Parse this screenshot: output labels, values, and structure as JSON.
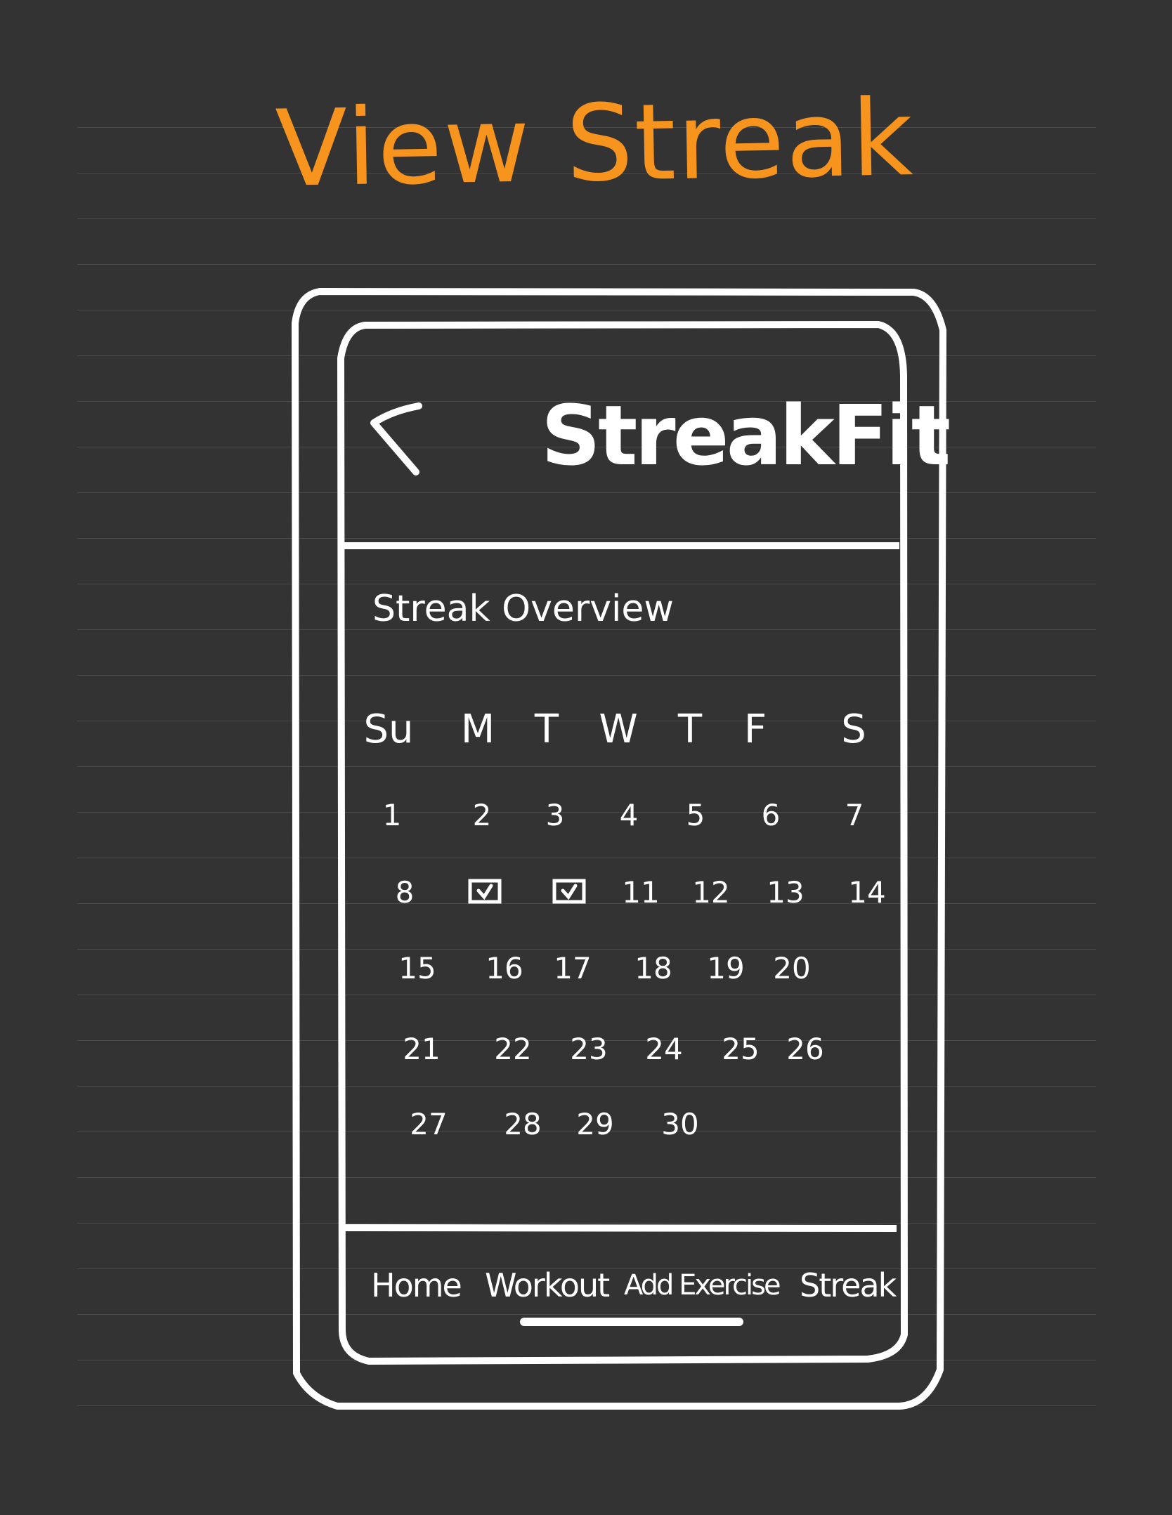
{
  "page_title": "View Streak",
  "app": {
    "title": "StreakFit",
    "back_icon": "chevron-left-icon"
  },
  "section_title": "Streak Overview",
  "calendar": {
    "weekdays": [
      "Su",
      "M",
      "T",
      "W",
      "T",
      "F",
      "S"
    ],
    "weeks": [
      [
        "1",
        "2",
        "3",
        "4",
        "5",
        "6",
        "7"
      ],
      [
        "8",
        "",
        "",
        "11",
        "12",
        "13",
        "14"
      ],
      [
        "15",
        "16",
        "17",
        "18",
        "19",
        "20"
      ],
      [
        "21",
        "22",
        "23",
        "24",
        "25",
        "26"
      ],
      [
        "27",
        "28",
        "29",
        "30"
      ]
    ],
    "checked_cells": [
      [
        1,
        1
      ],
      [
        1,
        2
      ]
    ],
    "check_icon": "checkbox-checked-icon"
  },
  "nav": {
    "items": [
      "Home",
      "Workout",
      "Add Exercise",
      "Streak"
    ]
  },
  "colors": {
    "background": "#333333",
    "title": "#f7941d",
    "ink": "#ffffff"
  }
}
